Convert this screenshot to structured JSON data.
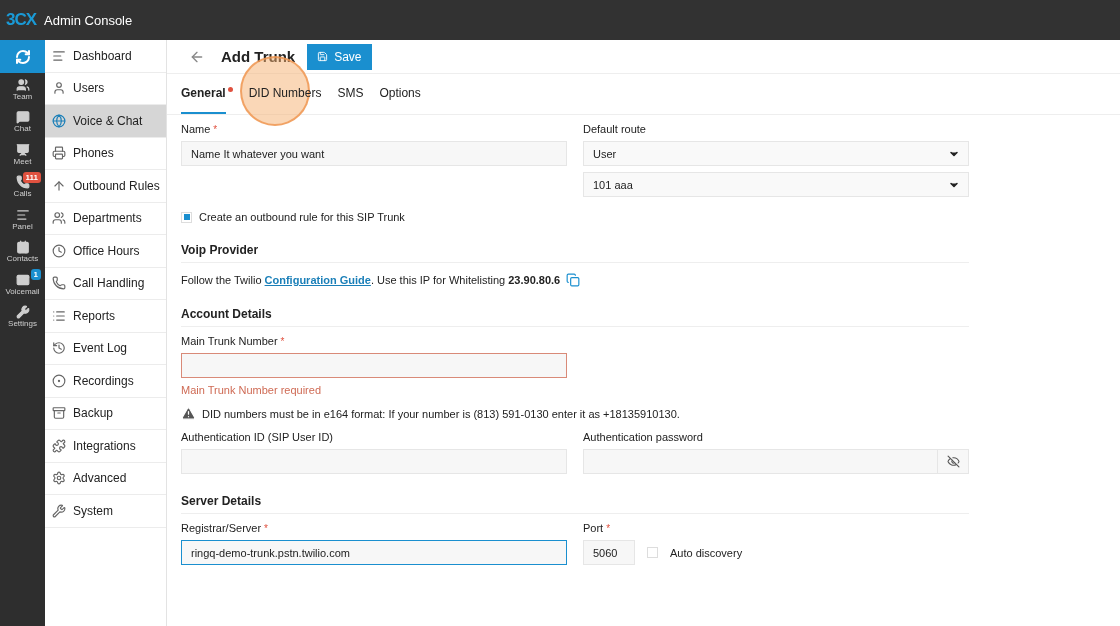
{
  "app": {
    "logo": "3CX",
    "title": "Admin Console"
  },
  "rail": [
    {
      "label": "Team"
    },
    {
      "label": "Chat"
    },
    {
      "label": "Meet"
    },
    {
      "label": "Calls",
      "badge": {
        "text": "111",
        "color": "#e0513f"
      }
    },
    {
      "label": "Panel"
    },
    {
      "label": "Contacts"
    },
    {
      "label": "Voicemail",
      "badge": {
        "text": "1",
        "color": "#1a8fcf"
      }
    },
    {
      "label": "Settings"
    }
  ],
  "nav": [
    {
      "label": "Dashboard",
      "selected": false
    },
    {
      "label": "Users",
      "selected": false
    },
    {
      "label": "Voice & Chat",
      "selected": true
    },
    {
      "label": "Phones",
      "selected": false
    },
    {
      "label": "Outbound Rules",
      "selected": false
    },
    {
      "label": "Departments",
      "selected": false
    },
    {
      "label": "Office Hours",
      "selected": false
    },
    {
      "label": "Call Handling",
      "selected": false
    },
    {
      "label": "Reports",
      "selected": false
    },
    {
      "label": "Event Log",
      "selected": false
    },
    {
      "label": "Recordings",
      "selected": false
    },
    {
      "label": "Backup",
      "selected": false
    },
    {
      "label": "Integrations",
      "selected": false
    },
    {
      "label": "Advanced",
      "selected": false
    },
    {
      "label": "System",
      "selected": false
    }
  ],
  "header": {
    "title": "Add Trunk",
    "save": "Save"
  },
  "tabs": [
    {
      "label": "General",
      "selected": true,
      "required": true,
      "highlighted": false
    },
    {
      "label": "DID Numbers",
      "selected": false,
      "required": false,
      "highlighted": true
    },
    {
      "label": "SMS",
      "selected": false,
      "required": false,
      "highlighted": false
    },
    {
      "label": "Options",
      "selected": false,
      "required": false,
      "highlighted": false
    }
  ],
  "general": {
    "name": {
      "label": "Name",
      "mark": "*",
      "value": "Name It whatever you want"
    },
    "default_route": {
      "label": "Default route",
      "selects": [
        "User",
        "101 aaa"
      ]
    },
    "outbound_rule": {
      "label": "Create an outbound rule for this SIP Trunk",
      "checked": true
    }
  },
  "voip": {
    "heading": "Voip Provider",
    "before": "Follow the Twilio",
    "link": "Configuration Guide",
    "after": ". Use this IP for Whitelisting **23.90.80.6**"
  },
  "account": {
    "heading": "Account Details",
    "main_trunk": {
      "label": "Main Trunk Number",
      "mark": "*",
      "invalid": true,
      "error": "Main Trunk Number required"
    },
    "notice": "DID numbers must be in e164 format: If your number is (813) 591-0130 enter it as +18135910130.",
    "auth_id": {
      "label": "Authentication ID (SIP User ID)"
    },
    "auth_password": {
      "label": "Authentication password"
    }
  },
  "server": {
    "heading": "Server Details",
    "registrar": {
      "label": "Registrar/Server",
      "mark": "*",
      "value": "ringq-demo-trunk.pstn.twilio.com",
      "focused": true
    },
    "port": {
      "label": "Port",
      "mark": "*",
      "value": "5060"
    },
    "auto_discovery": {
      "label": "Auto discovery",
      "checked": false
    }
  }
}
